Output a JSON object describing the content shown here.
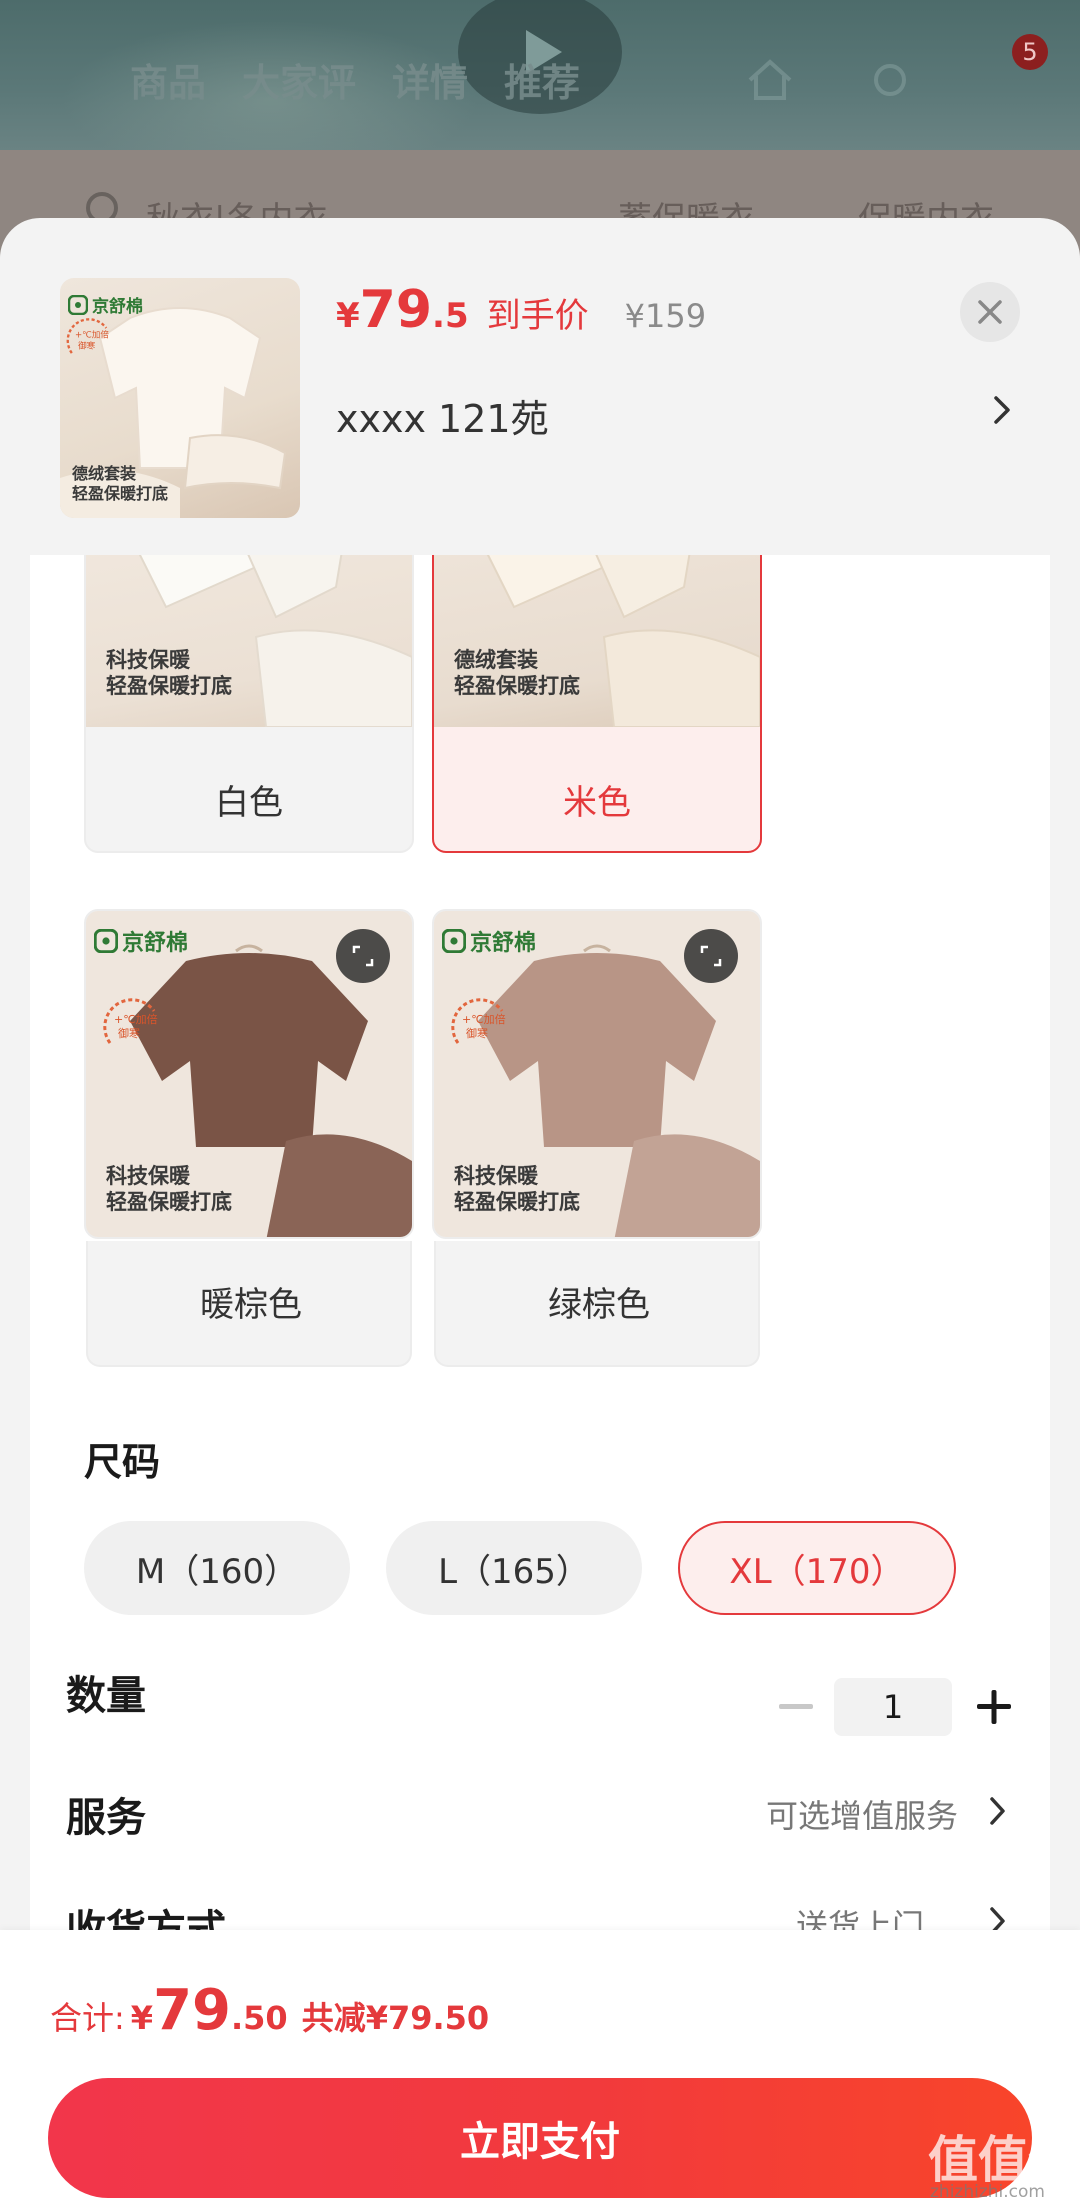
{
  "background": {
    "tabs": [
      "商品",
      "大家评",
      "详情",
      "推荐"
    ],
    "cart_badge": "5",
    "search_text": "秋衣|冬内衣",
    "search_tags": [
      "蓄保暖衣",
      "保暖内衣"
    ]
  },
  "product": {
    "thumb_brand": "京舒棉",
    "thumb_caption_1": "德绒套装",
    "thumb_caption_2": "轻盈保暖打底",
    "promo_text": "+℃加倍 御寒",
    "price_symbol": "¥",
    "price_int": "79",
    "price_dec": ".5",
    "price_tag": "到手价",
    "original_price": "¥159",
    "variant": "xxxx 121苑"
  },
  "colors": [
    {
      "label": "白色",
      "caption_1": "科技保暖",
      "caption_2": "轻盈保暖打底",
      "selected": false
    },
    {
      "label": "米色",
      "caption_1": "德绒套装",
      "caption_2": "轻盈保暖打底",
      "selected": true
    },
    {
      "label": "暖棕色",
      "caption_1": "科技保暖",
      "caption_2": "轻盈保暖打底",
      "selected": false
    },
    {
      "label": "绿棕色",
      "caption_1": "科技保暖",
      "caption_2": "轻盈保暖打底",
      "selected": false
    }
  ],
  "swatch_brand": "京舒棉",
  "size": {
    "title": "尺码",
    "options": [
      {
        "label": "M（160）",
        "selected": false
      },
      {
        "label": "L（165）",
        "selected": false
      },
      {
        "label": "XL（170）",
        "selected": true
      }
    ]
  },
  "quantity": {
    "label": "数量",
    "value": "1"
  },
  "service": {
    "label": "服务",
    "value": "可选增值服务"
  },
  "delivery": {
    "label": "收货方式",
    "value": "送货上门"
  },
  "footer": {
    "total_label": "合计:",
    "total_symbol": "¥",
    "total_int": "79",
    "total_dec": ".50",
    "discount": "共减¥79.50",
    "pay_label": "立即支付"
  },
  "watermark": {
    "text": "值值值",
    "url": "zhizhizhi.com"
  },
  "colors_palette": {
    "accent": "#e4393c",
    "pay_start": "#f2364b",
    "pay_end": "#f8452a"
  }
}
